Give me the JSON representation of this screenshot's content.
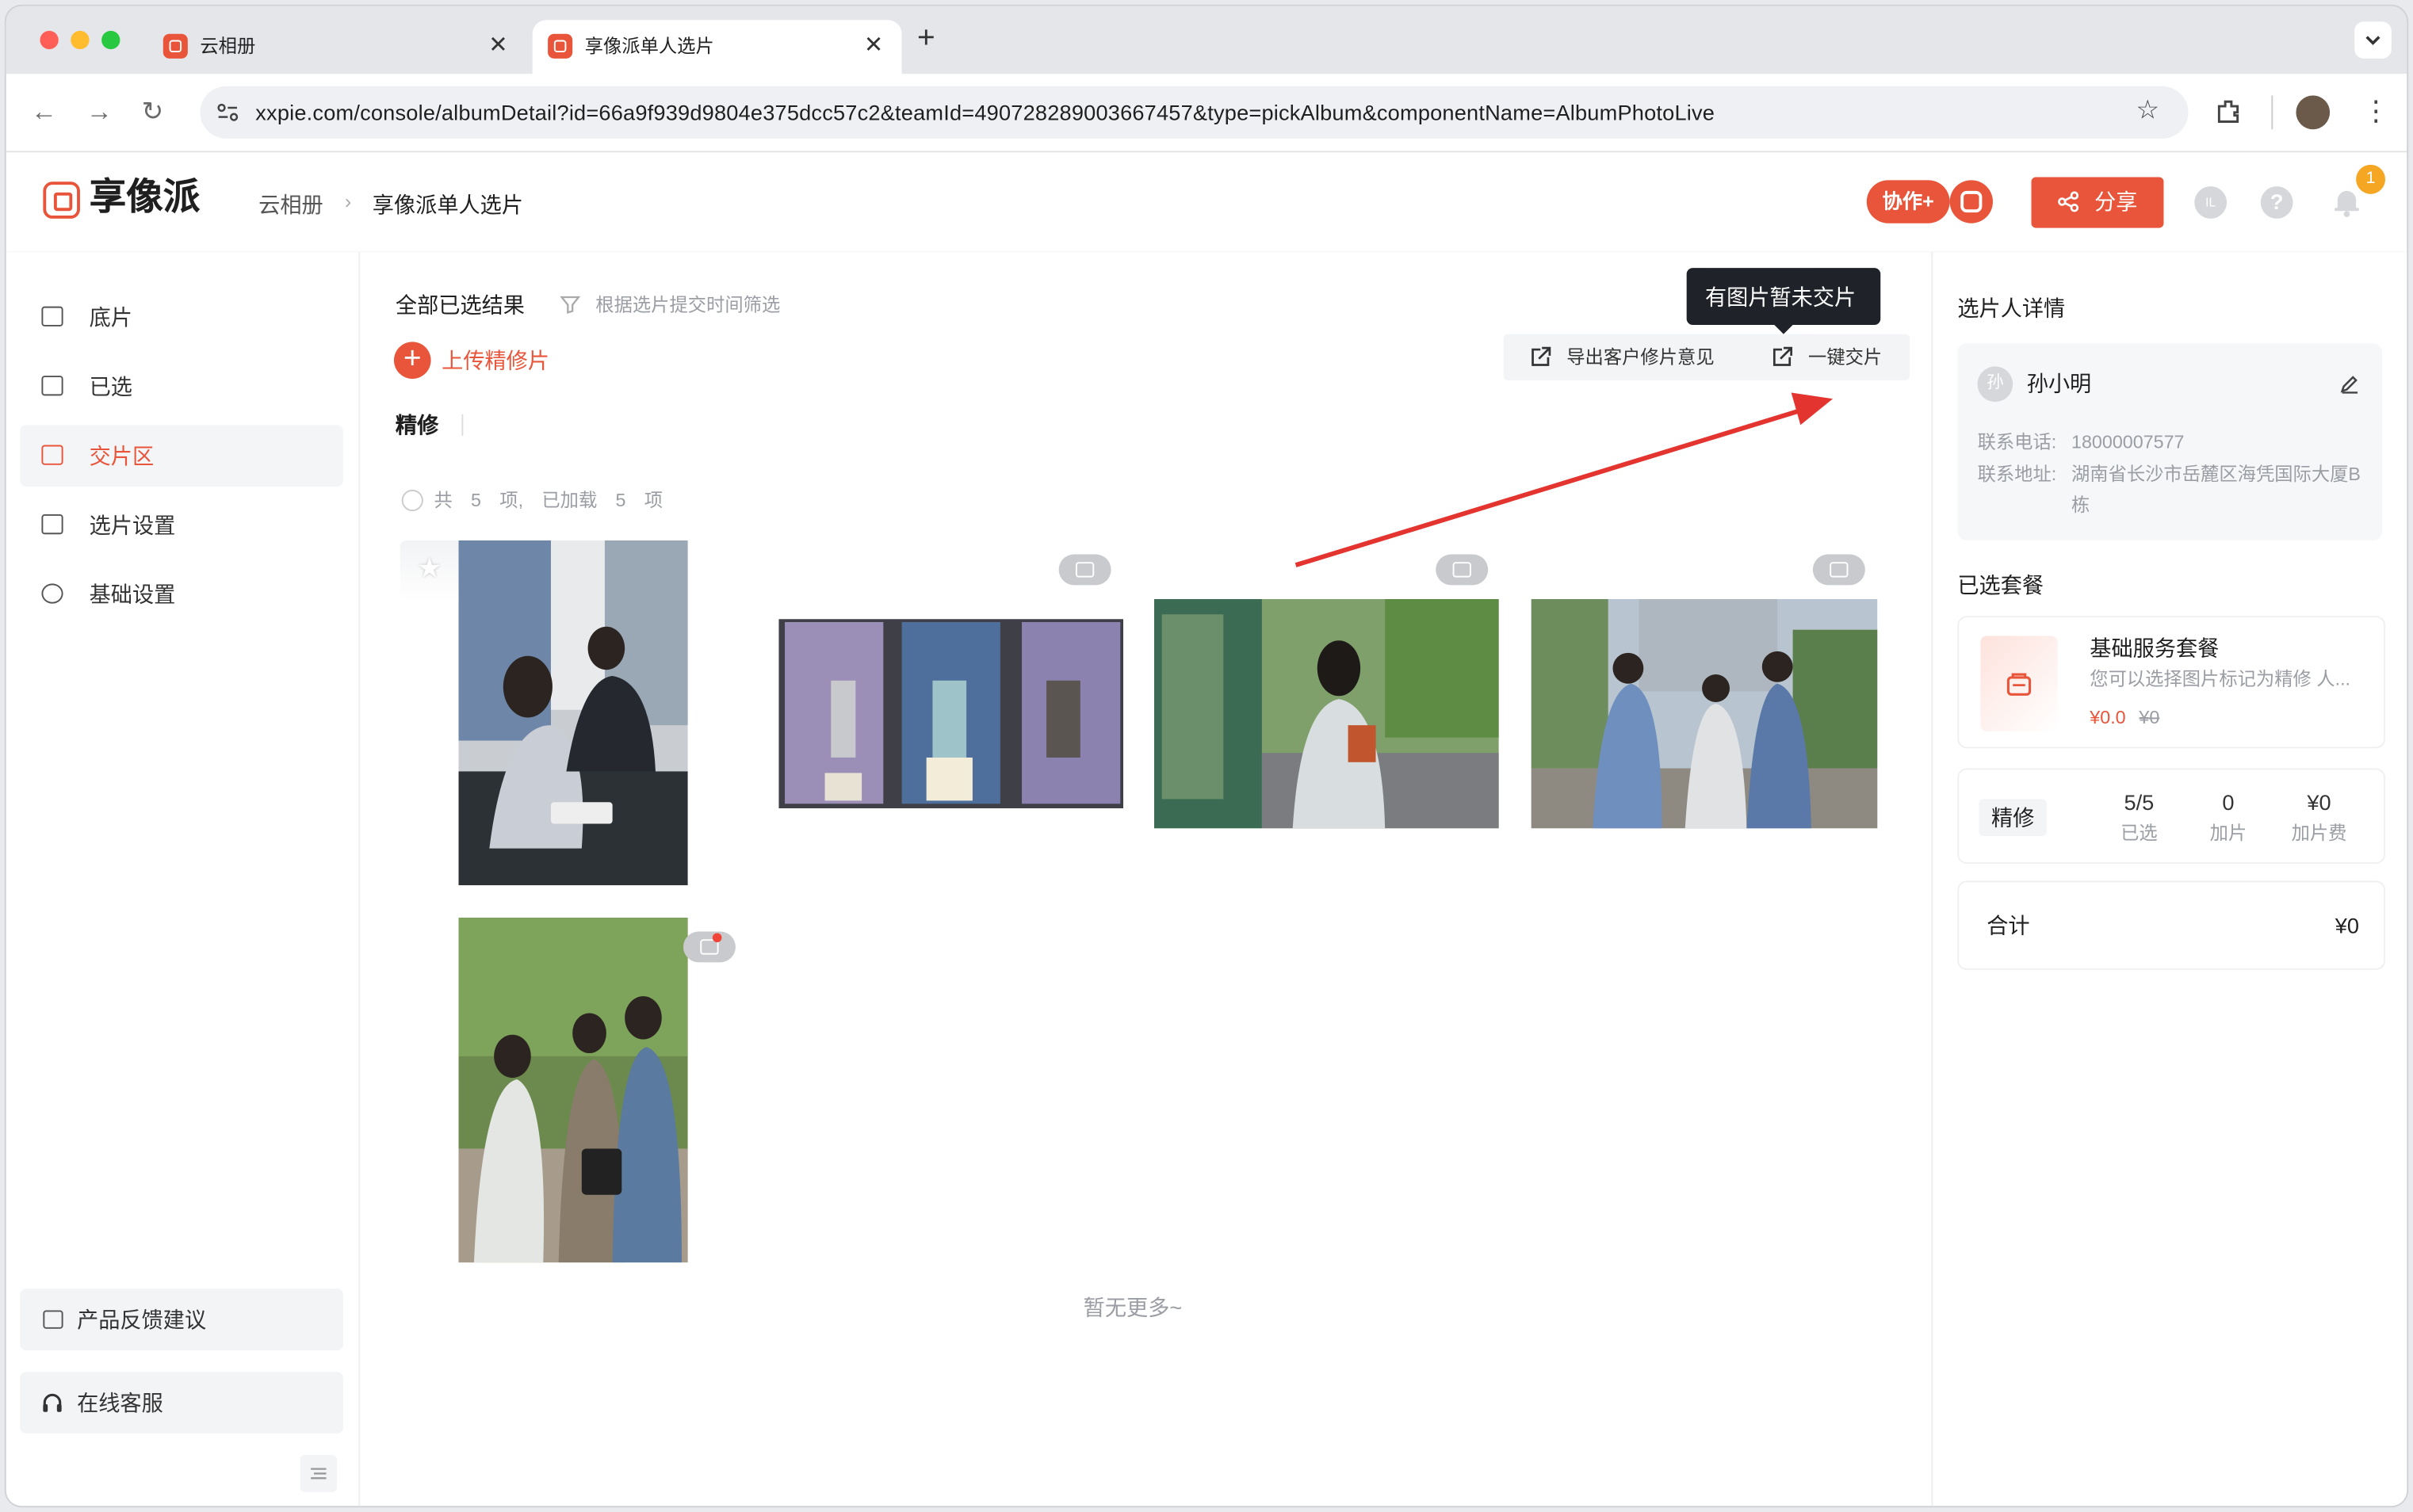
{
  "browser": {
    "tabs": [
      {
        "title": "云相册",
        "close": "✕"
      },
      {
        "title": "享像派单人选片",
        "close": "✕"
      }
    ],
    "new_tab": "+",
    "url": "xxpie.com/console/albumDetail?id=66a9f939d9804e375dcc57c2&teamId=490728289003667457&type=pickAlbum&componentName=AlbumPhotoLive"
  },
  "header": {
    "logo_text": "享像派",
    "breadcrumb": [
      "云相册",
      "享像派单人选片"
    ],
    "collab_label": "协作+",
    "share_label": "分享",
    "avatar_initial": "IL",
    "help": "?",
    "notification_count": "1"
  },
  "sidebar": {
    "items": [
      {
        "label": "底片"
      },
      {
        "label": "已选"
      },
      {
        "label": "交片区"
      },
      {
        "label": "选片设置"
      },
      {
        "label": "基础设置"
      }
    ],
    "feedback": "产品反馈建议",
    "service": "在线客服"
  },
  "main": {
    "title": "全部已选结果",
    "filter": "根据选片提交时间筛选",
    "upload": "上传精修片",
    "export": "导出客户修片意见",
    "deliver": "一键交片",
    "tooltip": "有图片暂未交片",
    "section": "精修",
    "count_text": "共　5　项,　已加载　5　项",
    "no_more": "暂无更多~"
  },
  "right": {
    "title": "选片人详情",
    "customer": {
      "avatar": "孙",
      "name": "孙小明",
      "phone_label": "联系电话:",
      "phone": "18000007577",
      "address_label": "联系地址:",
      "address": "湖南省长沙市岳麓区海凭国际大厦B栋"
    },
    "package_title": "已选套餐",
    "package": {
      "name": "基础服务套餐",
      "desc": "您可以选择图片标记为精修 人...",
      "price": "¥0.0",
      "old_price": "¥0"
    },
    "stats_tag": "精修",
    "stats": [
      {
        "value": "5/5",
        "label": "已选"
      },
      {
        "value": "0",
        "label": "加片"
      },
      {
        "value": "¥0",
        "label": "加片费"
      }
    ],
    "total_label": "合计",
    "total_value": "¥0"
  },
  "colors": {
    "accent": "#e8553a",
    "tooltip_bg": "#1f2329"
  },
  "icons": [
    "picture-icon",
    "edit-icon",
    "export-icon",
    "share-icon",
    "bell-icon",
    "help-icon",
    "comment-icon",
    "star-icon",
    "filter-icon",
    "headset-icon"
  ]
}
